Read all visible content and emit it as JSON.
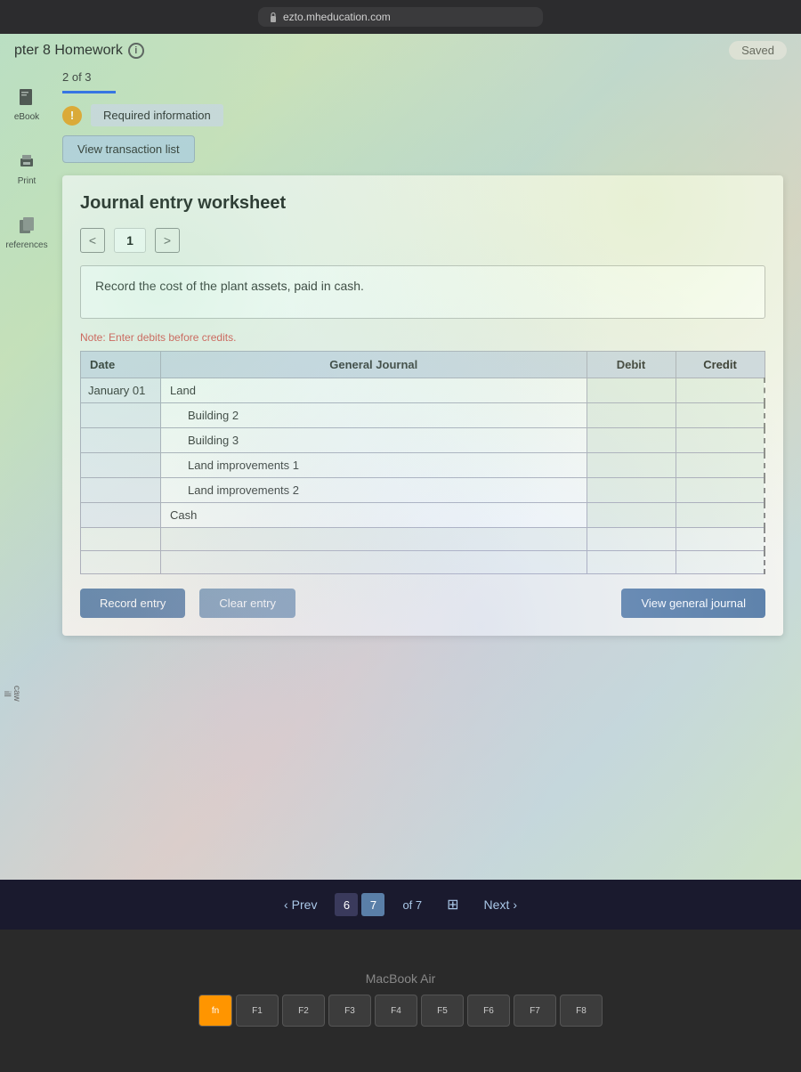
{
  "browser": {
    "url": "ezto.mheducation.com",
    "lock_icon": "lock"
  },
  "header": {
    "title": "pter 8 Homework",
    "info_icon": "i",
    "saved_label": "Saved"
  },
  "sidebar": {
    "items": [
      {
        "label": "eBook",
        "icon": "book"
      },
      {
        "label": "Print",
        "icon": "print"
      },
      {
        "label": "references",
        "icon": "copy"
      }
    ]
  },
  "page_indicator": {
    "text": "2 of 3"
  },
  "required_info": {
    "alert_icon": "!",
    "label": "Required information"
  },
  "view_transaction_btn": "View transaction list",
  "worksheet": {
    "title": "Journal entry worksheet",
    "nav": {
      "prev_arrow": "<",
      "next_arrow": ">",
      "current_page": "1"
    },
    "instruction": "Record the cost of the plant assets, paid in cash.",
    "note": "Note: Enter debits before credits.",
    "table": {
      "headers": [
        "Date",
        "General Journal",
        "Debit",
        "Credit"
      ],
      "rows": [
        {
          "date": "January 01",
          "account": "Land",
          "indent": false,
          "debit": "",
          "credit": ""
        },
        {
          "date": "",
          "account": "Building 2",
          "indent": true,
          "debit": "",
          "credit": ""
        },
        {
          "date": "",
          "account": "Building 3",
          "indent": true,
          "debit": "",
          "credit": ""
        },
        {
          "date": "",
          "account": "Land improvements 1",
          "indent": true,
          "debit": "",
          "credit": ""
        },
        {
          "date": "",
          "account": "Land improvements 2",
          "indent": true,
          "debit": "",
          "credit": ""
        },
        {
          "date": "",
          "account": "Cash",
          "indent": false,
          "debit": "",
          "credit": ""
        },
        {
          "date": "",
          "account": "",
          "indent": false,
          "debit": "",
          "credit": ""
        },
        {
          "date": "",
          "account": "",
          "indent": false,
          "debit": "",
          "credit": ""
        }
      ]
    },
    "buttons": {
      "record": "Record entry",
      "clear": "Clear entry",
      "view_journal": "View general journal"
    }
  },
  "bottom_nav": {
    "prev_label": "Prev",
    "next_label": "Next",
    "current_page_1": "6",
    "current_page_2": "7",
    "of_label": "of 7"
  },
  "keyboard": {
    "macbook_label": "MacBook Air",
    "keys": [
      "F1",
      "F2",
      "F3",
      "F4",
      "F5",
      "F6",
      "F7",
      "F8"
    ]
  },
  "side_label": {
    "line1": "c",
    "line2": "aw",
    "line3": "ill"
  }
}
